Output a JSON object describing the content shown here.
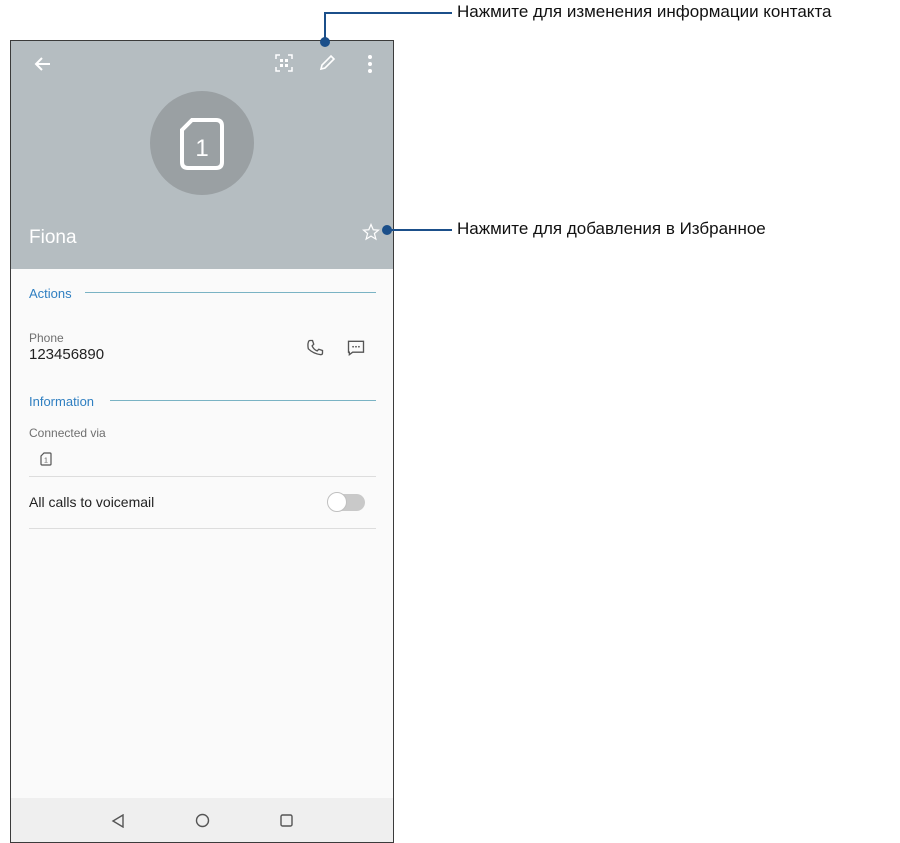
{
  "contact": {
    "name": "Fiona",
    "sim_number": "1"
  },
  "toolbar": {
    "back_icon": "back-arrow-icon",
    "qr_icon": "qr-code-icon",
    "edit_icon": "pencil-icon",
    "more_icon": "more-vert-icon",
    "favorite_icon": "star-outline-icon"
  },
  "actions": {
    "title": "Actions",
    "phone_label": "Phone",
    "phone_value": "123456890",
    "call_icon": "phone-icon",
    "message_icon": "message-icon"
  },
  "information": {
    "title": "Information",
    "connected_via_label": "Connected via",
    "sim_badge": "1",
    "voicemail_label": "All calls to voicemail",
    "voicemail_enabled": false
  },
  "navbar": {
    "back": "triangle-back-icon",
    "home": "circle-home-icon",
    "recents": "square-recents-icon"
  },
  "callouts": {
    "edit": "Нажмите для изменения информации контакта",
    "favorite": "Нажмите для добавления в Избранное"
  },
  "colors": {
    "header": "#b5bdc1",
    "accent": "#2f7fc1",
    "callout": "#1b4f8a"
  }
}
